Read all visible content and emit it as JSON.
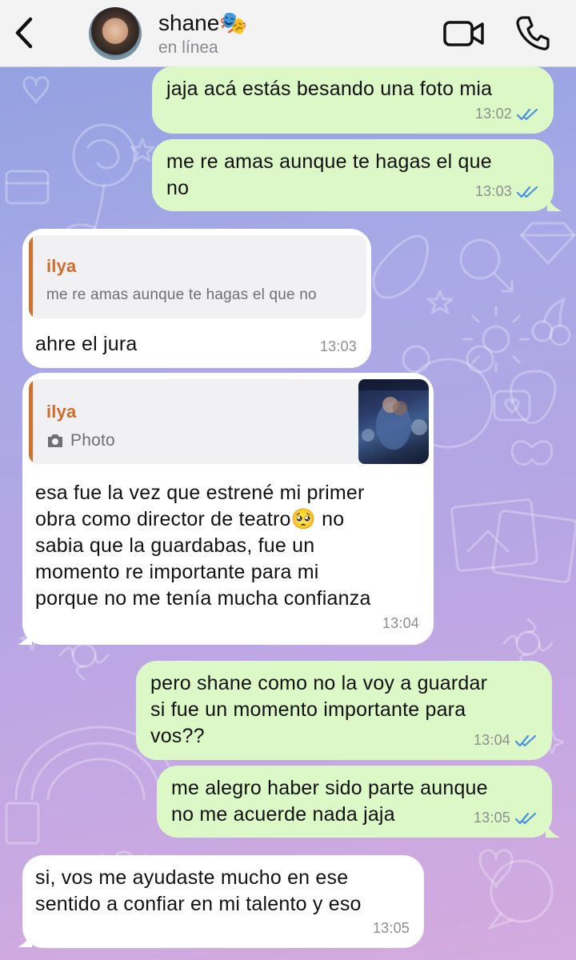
{
  "header": {
    "contact_name": "shane🎭",
    "status": "en línea"
  },
  "messages": [
    {
      "dir": "out",
      "text": "jaja acá estás besando una foto mia",
      "time": "13:02",
      "read": true
    },
    {
      "dir": "out",
      "text_lines": [
        "me re amas aunque te hagas el que",
        "no"
      ],
      "time": "13:03",
      "read": true
    },
    {
      "dir": "in",
      "reply_to": {
        "name": "ilya",
        "text": "me re amas aunque te hagas el que no"
      },
      "text": "ahre el jura",
      "time": "13:03"
    },
    {
      "dir": "in",
      "reply_to": {
        "name": "ilya",
        "text": "Photo"
      },
      "text_lines": [
        "esa fue la vez que estrené mi primer",
        "obra como director de teatro🥺 no",
        "sabia que la guardabas, fue un",
        "momento re importante para mi",
        "porque no me tenía mucha confianza"
      ],
      "time": "13:04"
    },
    {
      "dir": "out",
      "text_lines": [
        "pero shane como no la voy a guardar",
        "si fue un momento importante para",
        "vos??"
      ],
      "time": "13:04",
      "read": true
    },
    {
      "dir": "out",
      "text_lines": [
        "me alegro haber sido parte aunque",
        "no me acuerde nada jaja"
      ],
      "time": "13:05",
      "read": true
    },
    {
      "dir": "in",
      "text_lines": [
        "si, vos me ayudaste mucho en ese",
        "sentido a confiar en mi talento y eso"
      ],
      "time": "13:05"
    }
  ],
  "colors": {
    "outgoing_bubble": "#dcf8c6",
    "incoming_bubble": "#ffffff",
    "read_ticks": "#4a90e2",
    "reply_accent": "#d2702d"
  }
}
